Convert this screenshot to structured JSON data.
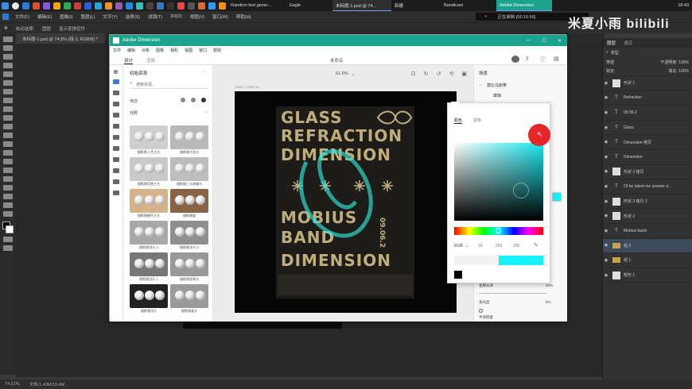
{
  "taskbar": {
    "tasks": [
      "Random text gener...",
      "Eagle",
      "新建",
      "Bandicam",
      "Adobe Dimension"
    ],
    "active_tab": "未标题-1.psd @ 74...",
    "record_status": "正在录制 [00:16:56]",
    "clock": "18:43"
  },
  "ps": {
    "menu": [
      "文件(F)",
      "编辑(E)",
      "图像(I)",
      "图层(L)",
      "文字(Y)",
      "选择(S)",
      "滤镜(T)",
      "3D(D)",
      "视图(V)",
      "窗口(W)",
      "帮助(H)"
    ],
    "options": [
      "自动选择:",
      "图层",
      "显示变换控件"
    ],
    "doc_tab": "未标题-1.psd @ 74.5% (组 3, RGB/8)",
    "status_zoom": "74.51%",
    "status_doc": "文档:1.43M/19.4M",
    "panel_tabs": [
      "图层",
      "通道"
    ],
    "kind_label": "类型",
    "blend": "穿透",
    "opacity_label": "不透明度:",
    "opacity": "100%",
    "lock_label": "锁定:",
    "fill_label": "填充:",
    "fill": "100%",
    "layers": [
      {
        "type": "img",
        "name": "形状 1"
      },
      {
        "type": "T",
        "name": "Refraction"
      },
      {
        "type": "T",
        "name": "09.06.2"
      },
      {
        "type": "T",
        "name": "Glass"
      },
      {
        "type": "T",
        "name": "Dimension 拷贝"
      },
      {
        "type": "T",
        "name": "Dimension"
      },
      {
        "type": "img",
        "name": "形状 2 拷贝"
      },
      {
        "type": "T",
        "name": "Of be talent me answer d..."
      },
      {
        "type": "img",
        "name": "形状 3 拷贝 2"
      },
      {
        "type": "img",
        "name": "形状 2"
      },
      {
        "type": "T",
        "name": "Mobius band"
      },
      {
        "type": "folder",
        "name": "组 3"
      },
      {
        "type": "folder",
        "name": "组 1"
      },
      {
        "type": "img",
        "name": "矩形 1"
      }
    ]
  },
  "watermark": "米夏小雨 bilibili",
  "dim": {
    "title": "Adobe Dimension",
    "menu": [
      "文件",
      "编辑",
      "对象",
      "图像",
      "相机",
      "视图",
      "窗口",
      "帮助"
    ],
    "mode_tabs": [
      "设计",
      "渲染"
    ],
    "doc_name": "未命名",
    "assets_title": "初始资源",
    "search_placeholder": "搜索资源...",
    "filter_label": "筛选",
    "category": "光照",
    "asset_labels": [
      "摄影棚 9 色主光",
      "摄影棚不直光",
      "摄影棚背景主光",
      "摄影棚上光源辅光",
      "摄影棚硬色主光",
      "摄影棚暖",
      "摄影棚顶光 A",
      "摄影棚顶光 B",
      "摄影棚顶光 C",
      "摄影棚背景光",
      "摄影棚顶光",
      "摄影棚柔光"
    ],
    "zoom": "61.5%",
    "canvas_size": "1000 x 1000 px",
    "scene_title": "场景",
    "scene_item": "莫比乌斯带",
    "scene_sub": "玻璃",
    "prop_metal_label": "金属光泽",
    "prop_metal_value": "40%",
    "prop_glow_label": "发光度",
    "prop_glow_value": "0%",
    "prop_bottom_label": "半透明度"
  },
  "poster": {
    "line1": "GLASS",
    "line2": "REFRACTION",
    "line3": "DIMENSION",
    "line4": "MOBIUS",
    "line5": "BAND",
    "line6": "DIMENSION",
    "date": "09.06.2"
  },
  "picker": {
    "tabs": [
      "颜色",
      "图像"
    ],
    "mode": "RGB",
    "r": "10",
    "g": "255",
    "b": "255",
    "color": "#16f1fa"
  },
  "colors": {
    "teal_titlebar": "#1aa48f",
    "poster_text": "#bfae7c",
    "selected_cyan": "#16f1fa",
    "record_red": "#e52727"
  }
}
